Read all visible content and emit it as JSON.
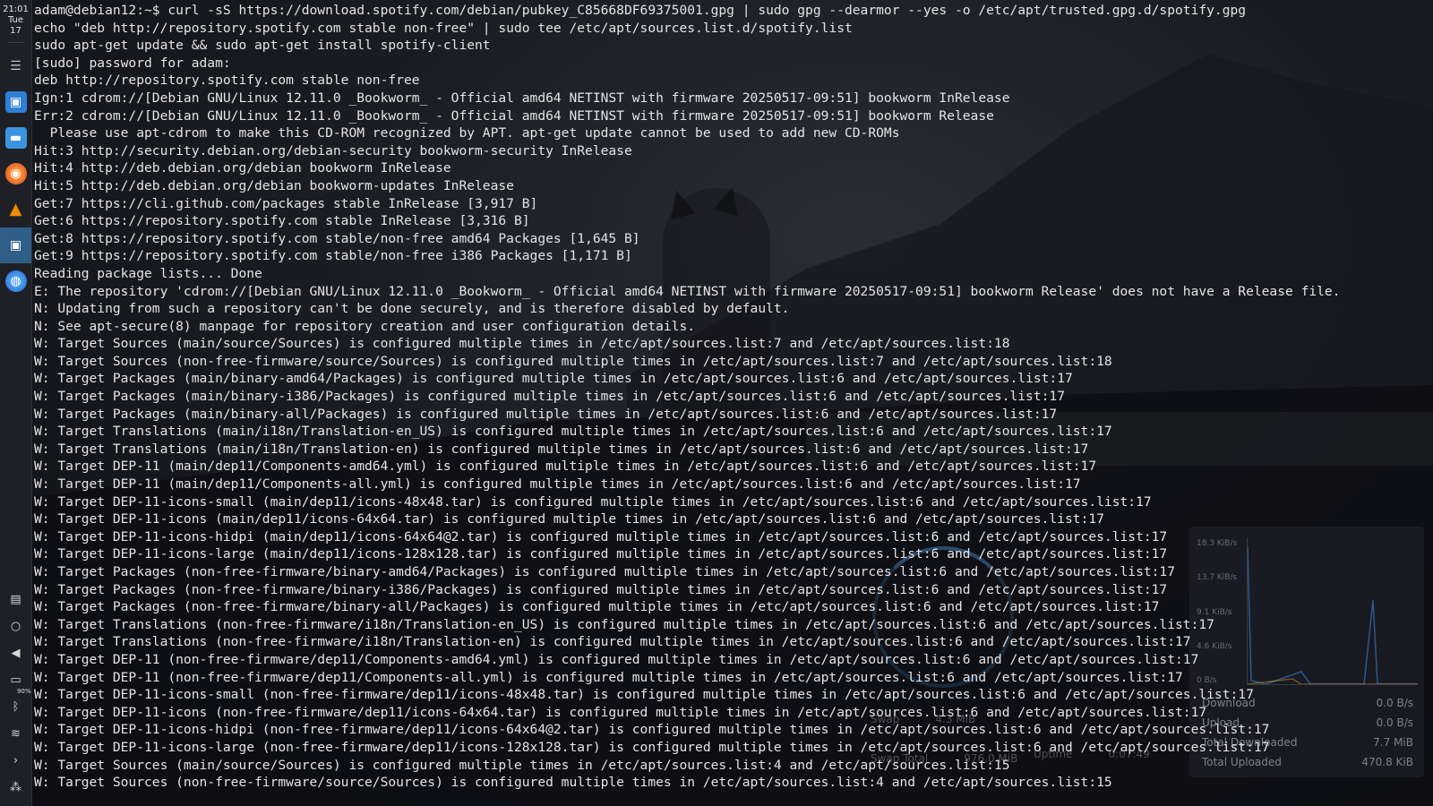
{
  "dock": {
    "time": "21:01",
    "day": "Tue",
    "date": "17",
    "battery_percent": "90%",
    "apps": [
      {
        "name": "system-settings",
        "glyph": "☰",
        "color": "#b8c4d6"
      },
      {
        "name": "software-store",
        "glyph": "🛍",
        "color": "#3a8ee6"
      },
      {
        "name": "file-manager",
        "glyph": "▬",
        "color": "#4aa3e8"
      },
      {
        "name": "firefox",
        "glyph": "◉",
        "color": "#ff7b1c"
      },
      {
        "name": "vlc",
        "glyph": "▲",
        "color": "#f08c00"
      },
      {
        "name": "terminal",
        "glyph": "▣",
        "color": "#e8e8e8"
      },
      {
        "name": "browser",
        "glyph": "◍",
        "color": "#2e8ee8"
      }
    ]
  },
  "terminal": {
    "lines": [
      "adam@debian12:~$ curl -sS https://download.spotify.com/debian/pubkey_C85668DF69375001.gpg | sudo gpg --dearmor --yes -o /etc/apt/trusted.gpg.d/spotify.gpg",
      "echo \"deb http://repository.spotify.com stable non-free\" | sudo tee /etc/apt/sources.list.d/spotify.list",
      "sudo apt-get update && sudo apt-get install spotify-client",
      "[sudo] password for adam:",
      "deb http://repository.spotify.com stable non-free",
      "Ign:1 cdrom://[Debian GNU/Linux 12.11.0 _Bookworm_ - Official amd64 NETINST with firmware 20250517-09:51] bookworm InRelease",
      "Err:2 cdrom://[Debian GNU/Linux 12.11.0 _Bookworm_ - Official amd64 NETINST with firmware 20250517-09:51] bookworm Release",
      "  Please use apt-cdrom to make this CD-ROM recognized by APT. apt-get update cannot be used to add new CD-ROMs",
      "Hit:3 http://security.debian.org/debian-security bookworm-security InRelease",
      "Hit:4 http://deb.debian.org/debian bookworm InRelease",
      "Hit:5 http://deb.debian.org/debian bookworm-updates InRelease",
      "Get:7 https://cli.github.com/packages stable InRelease [3,917 B]",
      "Get:6 https://repository.spotify.com stable InRelease [3,316 B]",
      "Get:8 https://repository.spotify.com stable/non-free amd64 Packages [1,645 B]",
      "Get:9 https://repository.spotify.com stable/non-free i386 Packages [1,171 B]",
      "Reading package lists... Done",
      "E: The repository 'cdrom://[Debian GNU/Linux 12.11.0 _Bookworm_ - Official amd64 NETINST with firmware 20250517-09:51] bookworm Release' does not have a Release file.",
      "N: Updating from such a repository can't be done securely, and is therefore disabled by default.",
      "N: See apt-secure(8) manpage for repository creation and user configuration details.",
      "W: Target Sources (main/source/Sources) is configured multiple times in /etc/apt/sources.list:7 and /etc/apt/sources.list:18",
      "W: Target Sources (non-free-firmware/source/Sources) is configured multiple times in /etc/apt/sources.list:7 and /etc/apt/sources.list:18",
      "W: Target Packages (main/binary-amd64/Packages) is configured multiple times in /etc/apt/sources.list:6 and /etc/apt/sources.list:17",
      "W: Target Packages (main/binary-i386/Packages) is configured multiple times in /etc/apt/sources.list:6 and /etc/apt/sources.list:17",
      "W: Target Packages (main/binary-all/Packages) is configured multiple times in /etc/apt/sources.list:6 and /etc/apt/sources.list:17",
      "W: Target Translations (main/i18n/Translation-en_US) is configured multiple times in /etc/apt/sources.list:6 and /etc/apt/sources.list:17",
      "W: Target Translations (main/i18n/Translation-en) is configured multiple times in /etc/apt/sources.list:6 and /etc/apt/sources.list:17",
      "W: Target DEP-11 (main/dep11/Components-amd64.yml) is configured multiple times in /etc/apt/sources.list:6 and /etc/apt/sources.list:17",
      "W: Target DEP-11 (main/dep11/Components-all.yml) is configured multiple times in /etc/apt/sources.list:6 and /etc/apt/sources.list:17",
      "W: Target DEP-11-icons-small (main/dep11/icons-48x48.tar) is configured multiple times in /etc/apt/sources.list:6 and /etc/apt/sources.list:17",
      "W: Target DEP-11-icons (main/dep11/icons-64x64.tar) is configured multiple times in /etc/apt/sources.list:6 and /etc/apt/sources.list:17",
      "W: Target DEP-11-icons-hidpi (main/dep11/icons-64x64@2.tar) is configured multiple times in /etc/apt/sources.list:6 and /etc/apt/sources.list:17",
      "W: Target DEP-11-icons-large (main/dep11/icons-128x128.tar) is configured multiple times in /etc/apt/sources.list:6 and /etc/apt/sources.list:17",
      "W: Target Packages (non-free-firmware/binary-amd64/Packages) is configured multiple times in /etc/apt/sources.list:6 and /etc/apt/sources.list:17",
      "W: Target Packages (non-free-firmware/binary-i386/Packages) is configured multiple times in /etc/apt/sources.list:6 and /etc/apt/sources.list:17",
      "W: Target Packages (non-free-firmware/binary-all/Packages) is configured multiple times in /etc/apt/sources.list:6 and /etc/apt/sources.list:17",
      "W: Target Translations (non-free-firmware/i18n/Translation-en_US) is configured multiple times in /etc/apt/sources.list:6 and /etc/apt/sources.list:17",
      "W: Target Translations (non-free-firmware/i18n/Translation-en) is configured multiple times in /etc/apt/sources.list:6 and /etc/apt/sources.list:17",
      "W: Target DEP-11 (non-free-firmware/dep11/Components-amd64.yml) is configured multiple times in /etc/apt/sources.list:6 and /etc/apt/sources.list:17",
      "W: Target DEP-11 (non-free-firmware/dep11/Components-all.yml) is configured multiple times in /etc/apt/sources.list:6 and /etc/apt/sources.list:17",
      "W: Target DEP-11-icons-small (non-free-firmware/dep11/icons-48x48.tar) is configured multiple times in /etc/apt/sources.list:6 and /etc/apt/sources.list:17",
      "W: Target DEP-11-icons (non-free-firmware/dep11/icons-64x64.tar) is configured multiple times in /etc/apt/sources.list:6 and /etc/apt/sources.list:17",
      "W: Target DEP-11-icons-hidpi (non-free-firmware/dep11/icons-64x64@2.tar) is configured multiple times in /etc/apt/sources.list:6 and /etc/apt/sources.list:17",
      "W: Target DEP-11-icons-large (non-free-firmware/dep11/icons-128x128.tar) is configured multiple times in /etc/apt/sources.list:6 and /etc/apt/sources.list:17",
      "W: Target Sources (main/source/Sources) is configured multiple times in /etc/apt/sources.list:4 and /etc/apt/sources.list:15",
      "W: Target Sources (non-free-firmware/source/Sources) is configured multiple times in /etc/apt/sources.list:4 and /etc/apt/sources.list:15"
    ]
  },
  "network_widget": {
    "axis_labels": [
      "18.3 KiB/s",
      "13.7 KiB/s",
      "9.1 KiB/s",
      "4.6 KiB/s",
      "0 B/s"
    ],
    "rows": [
      {
        "label": "Download",
        "value": "0.0 B/s"
      },
      {
        "label": "Upload",
        "value": "0.0 B/s"
      },
      {
        "label": "Total Downloaded",
        "value": "7.7 MiB"
      },
      {
        "label": "Total Uploaded",
        "value": "470.8 KiB"
      }
    ],
    "accent": "#3a8ee6"
  },
  "memory_widget": {
    "rows": [
      {
        "label": "Swap",
        "value": "4.3 MiB"
      },
      {
        "label": "Swap Total",
        "value": "976.0 MiB"
      },
      {
        "label": "Uptime",
        "value": "0:07:49"
      }
    ]
  }
}
